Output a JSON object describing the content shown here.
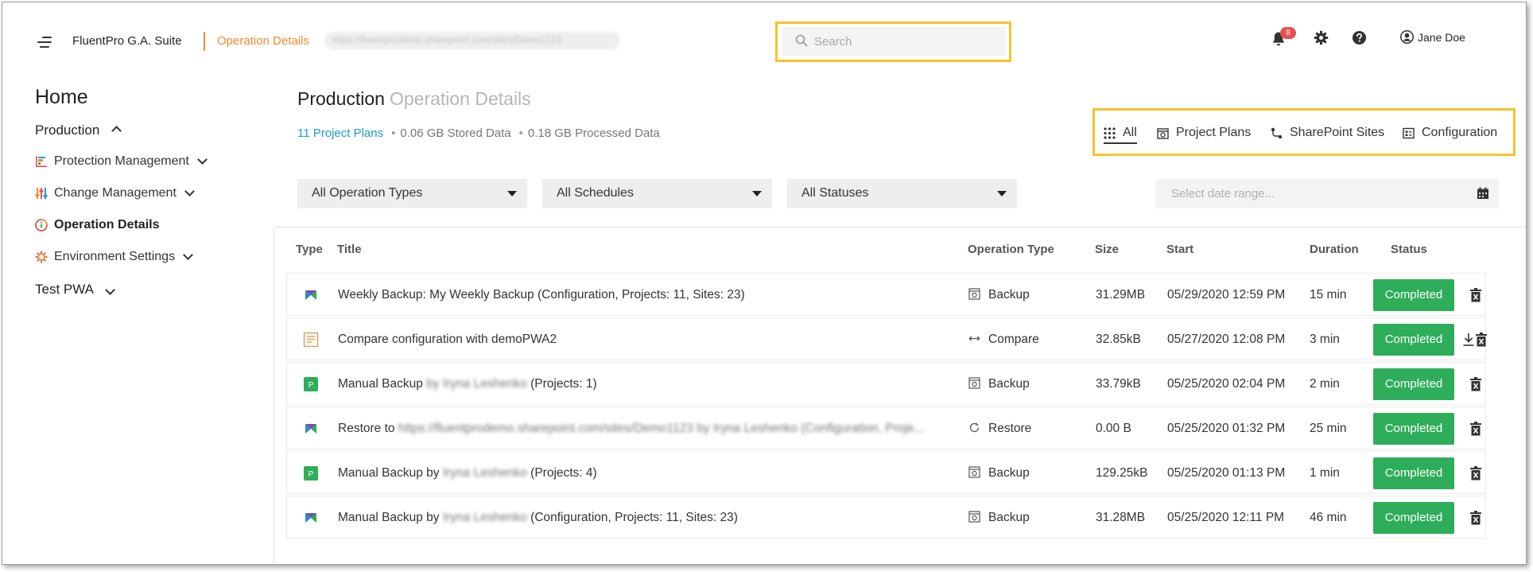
{
  "header": {
    "app_name": "FluentPro G.A. Suite",
    "page": "Operation Details",
    "url_blurred": "https://fluentprodemo.sharepoint.com/sites/Demo1123",
    "search_placeholder": "Search",
    "notifications_count": "8",
    "user_name": "Jane Doe"
  },
  "sidebar": {
    "home": "Home",
    "env_production": "Production",
    "items": [
      {
        "label": "Protection Management",
        "icon": "chart-bars-icon"
      },
      {
        "label": "Change Management",
        "icon": "sliders-icon"
      },
      {
        "label": "Operation Details",
        "icon": "info-icon"
      },
      {
        "label": "Environment Settings",
        "icon": "settings-sun-icon"
      }
    ],
    "env_test": "Test PWA"
  },
  "main": {
    "title": "Production",
    "subtitle": "Operation Details",
    "stats": {
      "project_plans": "11 Project Plans",
      "stored": "0.06 GB Stored Data",
      "processed": "0.18 GB Processed Data"
    },
    "tabs": [
      "All",
      "Project Plans",
      "SharePoint Sites",
      "Configuration"
    ],
    "filters": {
      "operation_types": "All Operation Types",
      "schedules": "All Schedules",
      "statuses": "All Statuses",
      "date_placeholder": "Select date range..."
    }
  },
  "table": {
    "columns": [
      "Type",
      "Title",
      "Operation Type",
      "Size",
      "Start",
      "Duration",
      "Status"
    ],
    "rows": [
      {
        "type_icon": "pwa-icon",
        "title": "Weekly Backup: My Weekly Backup (Configuration, Projects: 11, Sites: 23)",
        "title_pre": "",
        "title_blur": "",
        "title_post": "",
        "op_type": "Backup",
        "op_icon": "backup-icon",
        "size": "31.29MB",
        "start": "05/29/2020 12:59 PM",
        "duration": "15 min",
        "status": "Completed"
      },
      {
        "type_icon": "document-icon",
        "title": "Compare configuration with demoPWA2",
        "title_pre": "",
        "title_blur": "",
        "title_post": "",
        "op_type": "Compare",
        "op_icon": "compare-icon",
        "size": "32.85kB",
        "start": "05/27/2020 12:08 PM",
        "duration": "3 min",
        "status": "Completed"
      },
      {
        "type_icon": "project-icon",
        "title": "",
        "title_pre": "Manual Backup",
        "title_blur": "by Iryna Leshenko",
        "title_post": "(Projects: 1)",
        "op_type": "Backup",
        "op_icon": "backup-icon",
        "size": "33.79kB",
        "start": "05/25/2020 02:04 PM",
        "duration": "2 min",
        "status": "Completed"
      },
      {
        "type_icon": "pwa-icon",
        "title": "",
        "title_pre": "Restore to",
        "title_blur": "https://fluentprodemo.sharepoint.com/sites/Demo1123 by Iryna Leshenko (Configuration, Proje...",
        "title_post": "",
        "op_type": "Restore",
        "op_icon": "restore-icon",
        "size": "0.00 B",
        "start": "05/25/2020 01:32 PM",
        "duration": "25 min",
        "status": "Completed"
      },
      {
        "type_icon": "project-icon",
        "title": "",
        "title_pre": "Manual Backup by",
        "title_blur": "Iryna Leshenko",
        "title_post": "(Projects: 4)",
        "op_type": "Backup",
        "op_icon": "backup-icon",
        "size": "129.25kB",
        "start": "05/25/2020 01:13 PM",
        "duration": "1 min",
        "status": "Completed"
      },
      {
        "type_icon": "pwa-icon",
        "title": "",
        "title_pre": "Manual Backup by",
        "title_blur": "Iryna Leshenko",
        "title_post": "(Configuration, Projects: 11, Sites: 23)",
        "op_type": "Backup",
        "op_icon": "backup-icon",
        "size": "31.28MB",
        "start": "05/25/2020 12:11 PM",
        "duration": "46 min",
        "status": "Completed"
      }
    ]
  },
  "colors": {
    "accent_orange": "#f28a2e",
    "highlight_yellow": "#f6c32c",
    "status_green": "#2ead5a",
    "link_blue": "#1c9ad6",
    "badge_red": "#e8504d"
  }
}
